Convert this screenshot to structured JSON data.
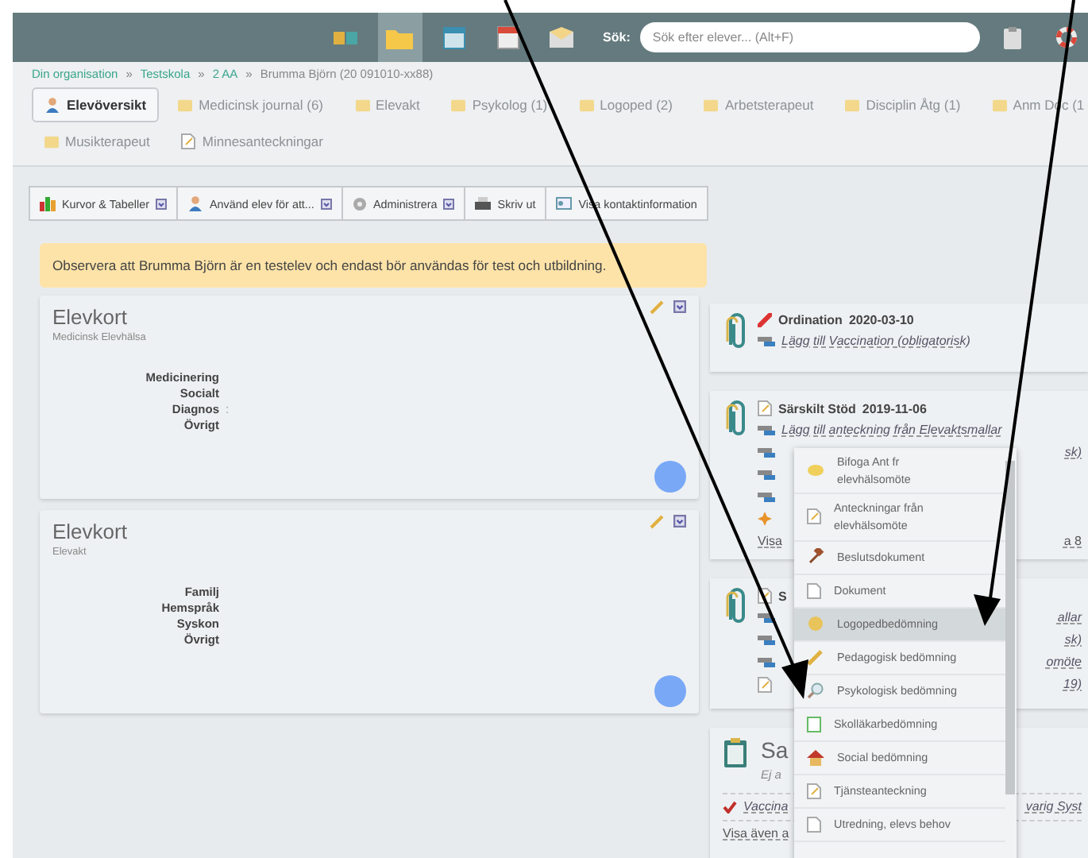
{
  "topbar": {
    "nav_icons": [
      {
        "selected": false
      },
      {
        "selected": true
      },
      {
        "selected": false
      },
      {
        "selected": false
      },
      {
        "selected": false
      }
    ],
    "search_label": "Sök:",
    "search": {
      "placeholder": "Sök efter elever... (Alt+F)"
    }
  },
  "breadcrumb": [
    {
      "kind": "link",
      "label": "Din organisation"
    },
    {
      "kind": "sep",
      "label": "»"
    },
    {
      "kind": "link",
      "label": "Testskola"
    },
    {
      "kind": "sep",
      "label": "»"
    },
    {
      "kind": "link",
      "label": "2 AA"
    },
    {
      "kind": "sep",
      "label": "»"
    },
    {
      "kind": "current",
      "label": "Brumma Björn (20 091010-xx88)"
    }
  ],
  "tabs": [
    {
      "label": "Elevöversikt",
      "selected": true,
      "kind": "person"
    },
    {
      "label": "Medicinsk journal (6)",
      "selected": false,
      "kind": "folder"
    },
    {
      "label": "Elevakt",
      "selected": false,
      "kind": "folder"
    },
    {
      "label": "Psykolog (1)",
      "selected": false,
      "kind": "folder"
    },
    {
      "label": "Logoped (2)",
      "selected": false,
      "kind": "folder"
    },
    {
      "label": "Arbetsterapeut",
      "selected": false,
      "kind": "folder"
    },
    {
      "label": "Disciplin Åtg (1)",
      "selected": false,
      "kind": "folder"
    },
    {
      "label": "Anm Doc (1",
      "selected": false,
      "kind": "folder"
    },
    {
      "label": "Musikterapeut",
      "selected": false,
      "kind": "folder"
    },
    {
      "label": "Minnesanteckningar",
      "selected": false,
      "kind": "note"
    }
  ],
  "toolbar": [
    {
      "label": "Kurvor & Tabeller",
      "dropdown": true
    },
    {
      "label": "Använd elev för att...",
      "dropdown": true
    },
    {
      "label": "Administrera",
      "dropdown": true
    },
    {
      "label": "Skriv ut",
      "dropdown": false
    },
    {
      "label": "Visa kontaktinformation",
      "dropdown": false
    }
  ],
  "notice": "Observera att Brumma Björn är en testelev och endast bör användas för test och utbildning.",
  "student_cards": [
    {
      "title": "Elevkort",
      "subtitle": "Medicinsk Elevhälsa",
      "fields": [
        {
          "label": "Medicinering"
        },
        {
          "label": "Socialt"
        },
        {
          "label": "Diagnos",
          "value": ":"
        },
        {
          "label": "Övrigt"
        }
      ]
    },
    {
      "title": "Elevkort",
      "subtitle": "Elevakt",
      "fields": [
        {
          "label": "Familj"
        },
        {
          "label": "Hemspråk"
        },
        {
          "label": "Syskon"
        },
        {
          "label": "Övrigt"
        }
      ]
    }
  ],
  "right_cards": [
    {
      "kind": "entry",
      "title": "Ordination",
      "date": "2020-03-10",
      "rows": [
        {
          "kind": "link",
          "start": "Lägg till Vaccination (obligatorisk)"
        }
      ]
    },
    {
      "kind": "entry",
      "title": "Särskilt Stöd",
      "date": "2019-11-06",
      "rows": [
        {
          "kind": "link",
          "start": "Lägg till anteckning från Elevaktsmallar"
        },
        {
          "kind": "link",
          "end": "sk)"
        },
        {
          "kind": "link"
        },
        {
          "kind": "link"
        },
        {
          "kind": "note"
        },
        {
          "kind": "footer",
          "start": "Visa",
          "end": "a 8"
        }
      ]
    },
    {
      "kind": "entry",
      "title": "S",
      "rows": [
        {
          "kind": "link",
          "end": "allar"
        },
        {
          "kind": "link",
          "end": "sk)"
        },
        {
          "kind": "link",
          "end": "omöte"
        },
        {
          "kind": "doc",
          "end": "19)"
        }
      ]
    },
    {
      "kind": "summary",
      "title": "Sa",
      "subtitle": "Ej a",
      "rows": [
        {
          "kind": "check",
          "start": "Vaccina",
          "end": "varig Syst"
        },
        {
          "kind": "footer",
          "start": "Visa även a"
        }
      ]
    }
  ],
  "context_menu": {
    "items": [
      {
        "label": "Bifoga Ant fr elevhälsomöte",
        "selected": false
      },
      {
        "label": "Anteckningar från elevhälsomöte",
        "selected": false
      },
      {
        "label": "Beslutsdokument",
        "selected": false
      },
      {
        "label": "Dokument",
        "selected": false
      },
      {
        "label": "Logopedbedömning",
        "selected": true
      },
      {
        "label": "Pedagogisk bedömning",
        "selected": false
      },
      {
        "label": "Psykologisk bedömning",
        "selected": false
      },
      {
        "label": "Skolläkarbedömning",
        "selected": false
      },
      {
        "label": "Social bedömning",
        "selected": false
      },
      {
        "label": "Tjänsteanteckning",
        "selected": false
      },
      {
        "label": "Utredning, elevs behov",
        "selected": false
      }
    ]
  }
}
